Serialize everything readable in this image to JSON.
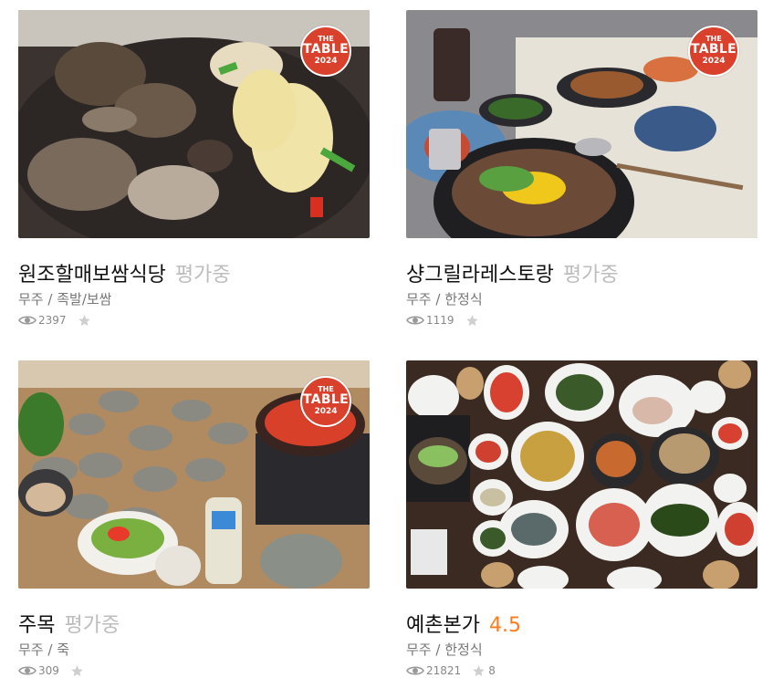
{
  "badge": {
    "line1": "THE",
    "line2": "TABLE",
    "line3": "2024"
  },
  "restaurants": [
    {
      "name": "원조할매보쌈식당",
      "score": "평가중",
      "region": "무주",
      "category": "족발/보쌈",
      "views": "2397",
      "reviews": "",
      "photo": "mushroom-hotpot-photo"
    },
    {
      "name": "샹그릴라레스토랑",
      "score": "평가중",
      "region": "무주",
      "category": "한정식",
      "views": "1119",
      "reviews": "",
      "photo": "bibimbap-table-photo"
    },
    {
      "name": "주목",
      "score": "평가중",
      "region": "무주",
      "category": "죽",
      "views": "309",
      "reviews": "",
      "photo": "side-dishes-table-photo"
    },
    {
      "name": "예촌본가",
      "score": "4.5",
      "region": "무주",
      "category": "한정식",
      "views": "21821",
      "reviews": "8",
      "photo": "korean-course-meal-photo"
    }
  ],
  "separator": "/",
  "colors": {
    "pending_score": "#bdbdbd",
    "rated_score": "#ff7a1a",
    "badge": "#d9412c"
  }
}
